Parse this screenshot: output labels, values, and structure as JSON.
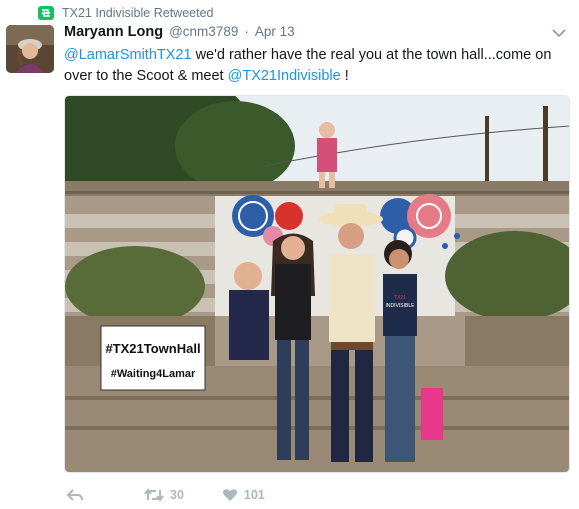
{
  "retweet_context": {
    "text": "TX21 Indivisible Retweeted",
    "icon": "retweet-icon"
  },
  "author": {
    "name": "Maryann Long",
    "handle": "@cnm3789",
    "separator": "·",
    "date": "Apr 13"
  },
  "tweet": {
    "mention1": "@LamarSmithTX21",
    "text1": " we'd rather have the real you at the town hall...come on over to the Scoot & meet ",
    "mention2": "@TX21Indivisible",
    "text2": " !"
  },
  "media": {
    "sign_line1": "#TX21TownHall",
    "sign_line2": "#Waiting4Lamar",
    "shirt_text1": "TX21",
    "shirt_text2": "INDIVISIBLE"
  },
  "actions": {
    "reply_icon": "reply-icon",
    "retweet_count": "30",
    "like_count": "101"
  },
  "colors": {
    "link": "#1b95e0",
    "retweet_green": "#17bf63",
    "muted": "#657786",
    "action_gray": "#aab8c2"
  }
}
